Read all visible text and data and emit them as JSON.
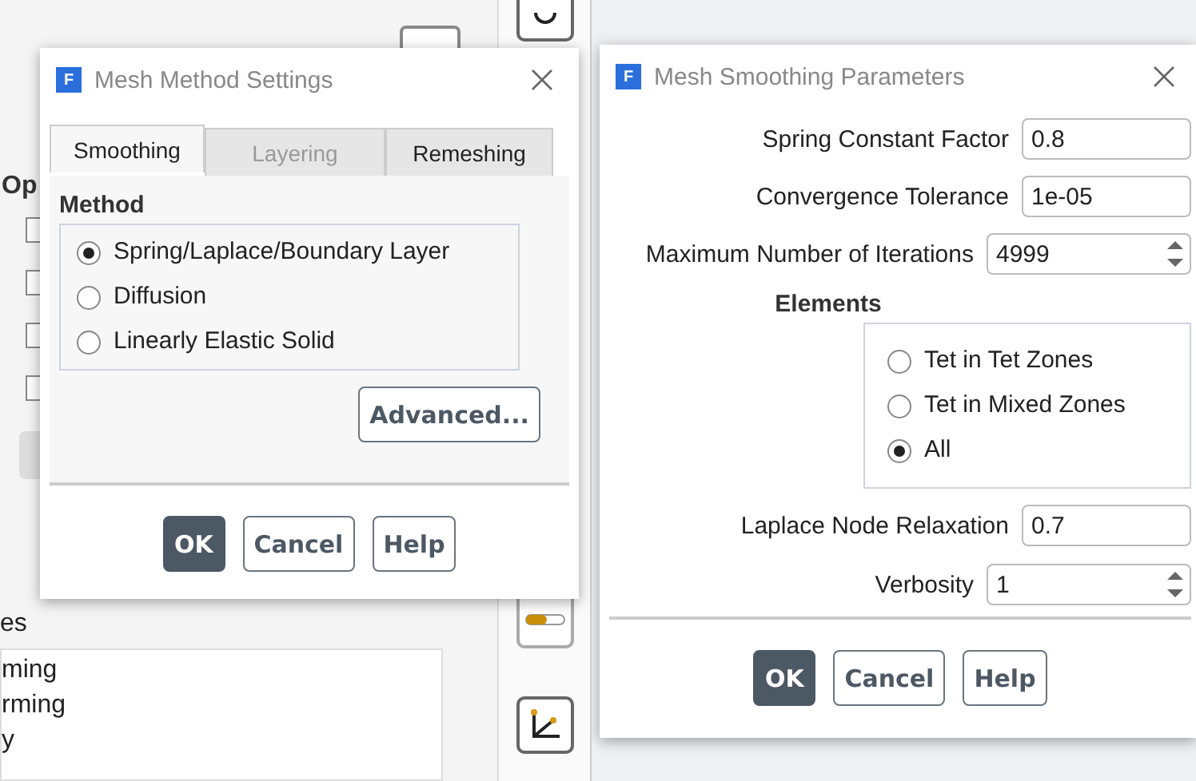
{
  "background_panel": {
    "heading": "Op",
    "checkboxes": [
      {
        "checked": false
      },
      {
        "checked": false
      },
      {
        "checked": false
      },
      {
        "checked": false
      }
    ],
    "section_label": "es",
    "list_items": [
      "ming",
      "rming",
      "y"
    ]
  },
  "mesh_method_dialog": {
    "logo": "F",
    "title": "Mesh Method Settings",
    "tabs": [
      {
        "label": "Smoothing",
        "selected": true,
        "disabled": false
      },
      {
        "label": "Layering",
        "selected": false,
        "disabled": true
      },
      {
        "label": "Remeshing",
        "selected": false,
        "disabled": false
      }
    ],
    "group_label": "Method",
    "methods": [
      {
        "label": "Spring/Laplace/Boundary Layer",
        "selected": true
      },
      {
        "label": "Diffusion",
        "selected": false
      },
      {
        "label": "Linearly Elastic Solid",
        "selected": false
      }
    ],
    "advanced_button": "Advanced...",
    "buttons": [
      {
        "label": "OK",
        "default": true
      },
      {
        "label": "Cancel",
        "default": false
      },
      {
        "label": "Help",
        "default": false
      }
    ]
  },
  "smoothing_dialog": {
    "logo": "F",
    "title": "Mesh Smoothing Parameters",
    "fields": [
      {
        "label": "Spring Constant Factor",
        "value": "0.8",
        "kind": "text"
      },
      {
        "label": "Convergence Tolerance",
        "value": "1e-05",
        "kind": "text"
      },
      {
        "label": "Maximum Number of Iterations",
        "value": "4999",
        "kind": "spinner"
      }
    ],
    "elements_label": "Elements",
    "elements": [
      {
        "label": "Tet in Tet Zones",
        "selected": false
      },
      {
        "label": "Tet in Mixed Zones",
        "selected": false
      },
      {
        "label": "All",
        "selected": true
      }
    ],
    "fields_after": [
      {
        "label": "Laplace Node Relaxation",
        "value": "0.7",
        "kind": "text"
      },
      {
        "label": "Verbosity",
        "value": "1",
        "kind": "spinner"
      }
    ],
    "buttons": [
      {
        "label": "OK",
        "default": true
      },
      {
        "label": "Cancel",
        "default": false
      },
      {
        "label": "Help",
        "default": false
      }
    ]
  }
}
